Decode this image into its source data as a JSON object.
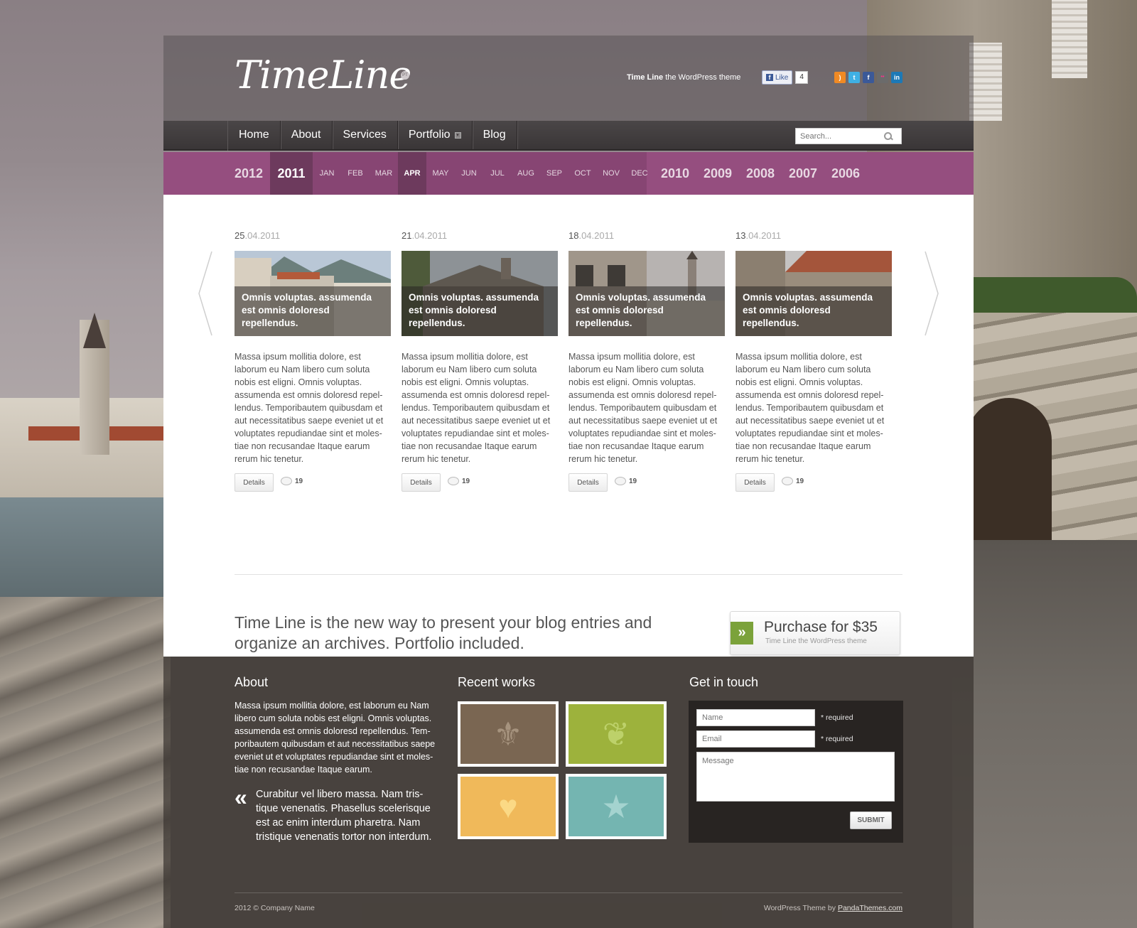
{
  "header": {
    "logo": "TimeLine",
    "logo_badge": "PT",
    "tagline_bold": "Time Line",
    "tagline_rest": " the WordPress theme",
    "fb_like_label": "Like",
    "fb_like_count": "4"
  },
  "social": [
    {
      "icon": "rss-icon",
      "glyph": ")",
      "color": "#f08a24"
    },
    {
      "icon": "twitter-icon",
      "glyph": "t",
      "color": "#3fb0e4"
    },
    {
      "icon": "facebook-icon",
      "glyph": "f",
      "color": "#3b5998"
    },
    {
      "icon": "flickr-icon",
      "glyph": "••",
      "color": "#6b6b6b"
    },
    {
      "icon": "linkedin-icon",
      "glyph": "in",
      "color": "#1d79b6"
    }
  ],
  "nav": {
    "items": [
      "Home",
      "About",
      "Services",
      "Portfolio",
      "Blog"
    ],
    "search_placeholder": "Search..."
  },
  "timeline": {
    "years_before": [
      "2012"
    ],
    "active_year": "2011",
    "months": [
      "JAN",
      "FEB",
      "MAR",
      "APR",
      "MAY",
      "JUN",
      "JUL",
      "AUG",
      "SEP",
      "OCT",
      "NOV",
      "DEC"
    ],
    "active_month": "APR",
    "years_after": [
      "2010",
      "2009",
      "2008",
      "2007",
      "2006"
    ]
  },
  "posts": [
    {
      "day": "25",
      "rest": ".04.2011",
      "caption": "Omnis voluptas. assumenda est omnis doloresd repellendus.",
      "text": "Massa ipsum mollitia dolore, est laborum eu Nam libero cum soluta nobis est eligni. Omnis voluptas. assumenda est omnis doloresd repel-lendus. Temporibautem quibusdam et aut necessitatibus saepe eveniet ut et voluptates repudiandae sint et moles-tiae non recusandae Itaque earum rerum hic tenetur.",
      "details": "Details",
      "comments": "19"
    },
    {
      "day": "21",
      "rest": ".04.2011",
      "caption": "Omnis voluptas. assumenda est omnis doloresd repellendus.",
      "text": "Massa ipsum mollitia dolore, est laborum eu Nam libero cum soluta nobis est eligni. Omnis voluptas. assumenda est omnis doloresd repel-lendus. Temporibautem quibusdam et aut necessitatibus saepe eveniet ut et voluptates repudiandae sint et moles-tiae non recusandae Itaque earum rerum hic tenetur.",
      "details": "Details",
      "comments": "19"
    },
    {
      "day": "18",
      "rest": ".04.2011",
      "caption": "Omnis voluptas. assumenda est omnis doloresd repellendus.",
      "text": "Massa ipsum mollitia dolore, est laborum eu Nam libero cum soluta nobis est eligni. Omnis voluptas. assumenda est omnis doloresd repel-lendus. Temporibautem quibusdam et aut necessitatibus saepe eveniet ut et voluptates repudiandae sint et moles-tiae non recusandae Itaque earum rerum hic tenetur.",
      "details": "Details",
      "comments": "19"
    },
    {
      "day": "13",
      "rest": ".04.2011",
      "caption": "Omnis voluptas. assumenda est omnis doloresd repellendus.",
      "text": "Massa ipsum mollitia dolore, est laborum eu Nam libero cum soluta nobis est eligni. Omnis voluptas. assumenda est omnis doloresd repel-lendus. Temporibautem quibusdam et aut necessitatibus saepe eveniet ut et voluptates repudiandae sint et moles-tiae non recusandae Itaque earum rerum hic tenetur.",
      "details": "Details",
      "comments": "19"
    }
  ],
  "promo": {
    "text": "Time Line is the new way to present your blog entries and organize an archives. Portfolio included.",
    "purchase_label": "Purchase for $35",
    "purchase_sub": "Time Line the WordPress theme"
  },
  "footer": {
    "about_title": "About",
    "about_text": "Massa ipsum mollitia dolore, est laborum eu Nam libero cum soluta nobis est eligni. Omnis voluptas. assumenda est omnis doloresd repellendus. Tem-poribautem quibusdam et aut necessitatibus saepe eveniet ut et voluptates repudiandae sint et moles-tiae non recusandae Itaque earum.",
    "quote": "Curabitur vel libero massa. Nam tris-tique venenatis. Phasellus scelerisque est ac enim interdum pharetra. Nam tristique venenatis tortor non interdum.",
    "works_title": "Recent works",
    "works": [
      {
        "icon": "fleur-de-lis-icon",
        "glyph": "⚜",
        "bg": "#7a6652",
        "fg": "#a6937e"
      },
      {
        "icon": "leaf-icon",
        "glyph": "❦",
        "bg": "#9db23c",
        "fg": "#bdd16a"
      },
      {
        "icon": "heart-icon",
        "glyph": "♥",
        "bg": "#f0b95a",
        "fg": "#fbd985"
      },
      {
        "icon": "star-icon",
        "glyph": "★",
        "bg": "#74b5b1",
        "fg": "#a4d3cf"
      }
    ],
    "contact_title": "Get in touch",
    "name_placeholder": "Name",
    "email_placeholder": "Email",
    "required": "* required",
    "message_placeholder": "Message",
    "submit": "SUBMIT",
    "copyright": "2012 © Company Name",
    "credit_prefix": "WordPress Theme by ",
    "credit_link": "PandaThemes.com"
  },
  "colors": {
    "timeline": "#954e7f",
    "timeline_active": "#6d3a5d",
    "purchase_accent": "#7ba23a"
  }
}
